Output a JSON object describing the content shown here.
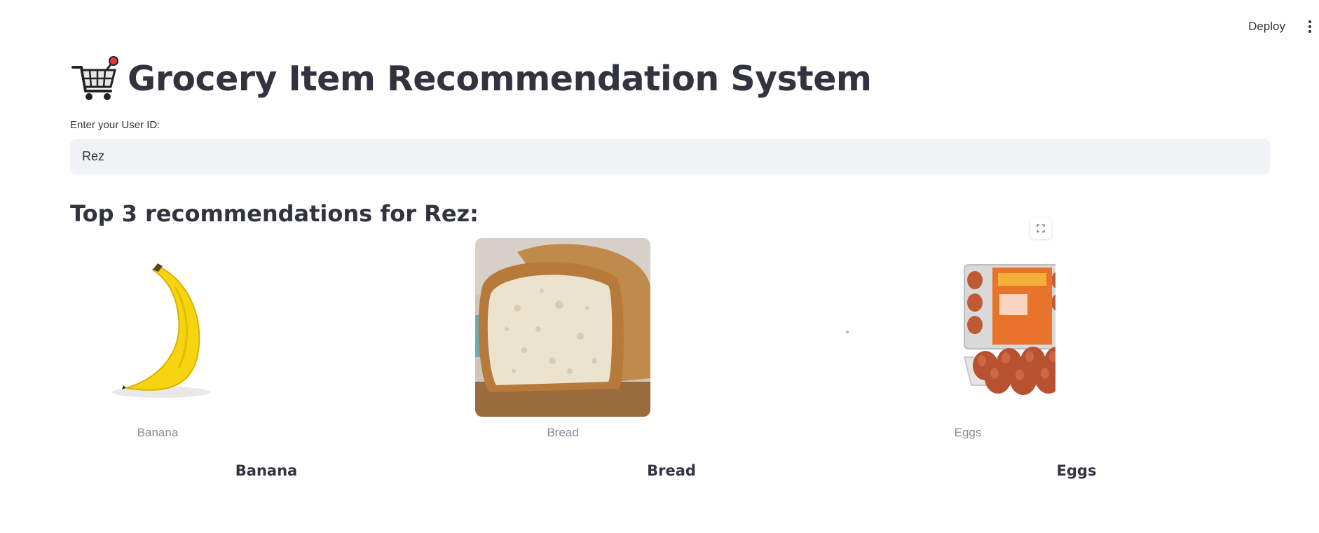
{
  "toolbar": {
    "deploy_label": "Deploy",
    "menu_icon": "vertical-ellipsis-icon"
  },
  "header": {
    "title": "Grocery Item Recommendation System",
    "title_icon": "shopping-cart-icon"
  },
  "user_input": {
    "label": "Enter your User ID:",
    "value": "Rez"
  },
  "recommendations": {
    "heading": "Top 3 recommendations for Rez:",
    "items": [
      {
        "caption": "Banana",
        "name": "Banana",
        "image": "banana-image"
      },
      {
        "caption": "Bread",
        "name": "Bread",
        "image": "bread-image"
      },
      {
        "caption": "Eggs",
        "name": "Eggs",
        "image": "eggs-carton-image"
      }
    ]
  },
  "colors": {
    "text": "#31333f",
    "input_bg": "#f0f2f6",
    "caption": "#8a8d96",
    "banana_yellow": "#f6d40f",
    "egg_brown": "#c05a35"
  }
}
